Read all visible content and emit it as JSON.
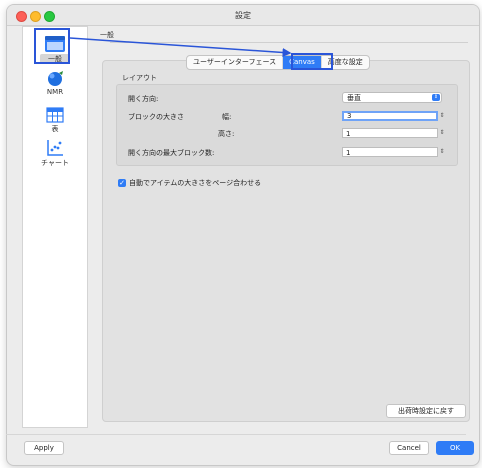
{
  "window": {
    "title": "設定"
  },
  "sidebar": {
    "items": [
      {
        "label": "一般",
        "icon": "general-icon",
        "selected": true
      },
      {
        "label": "NMR",
        "icon": "nmr-icon"
      },
      {
        "label": "表",
        "icon": "table-icon"
      },
      {
        "label": "チャート",
        "icon": "chart-icon"
      }
    ]
  },
  "section": {
    "title": "一般"
  },
  "tabs": [
    {
      "label": "ユーザーインターフェース"
    },
    {
      "label": "Canvas",
      "active": true
    },
    {
      "label": "高度な設定"
    }
  ],
  "layout": {
    "group_label": "レイアウト",
    "open_direction_label": "開く方向:",
    "open_direction_value": "垂直",
    "block_size_label": "ブロックの大きさ",
    "width_label": "幅:",
    "width_value": "3",
    "height_label": "高さ:",
    "height_value": "1",
    "max_blocks_label": "開く方向の最大ブロック数:",
    "max_blocks_value": "1"
  },
  "options": {
    "auto_fit_label": "自動でアイテムの大きさをページ合わせる",
    "auto_fit_checked": true
  },
  "buttons": {
    "reset": "出荷時設定に戻す",
    "apply": "Apply",
    "cancel": "Cancel",
    "ok": "OK"
  },
  "colors": {
    "accent": "#2f7cf6",
    "annotation": "#2a55d8"
  }
}
